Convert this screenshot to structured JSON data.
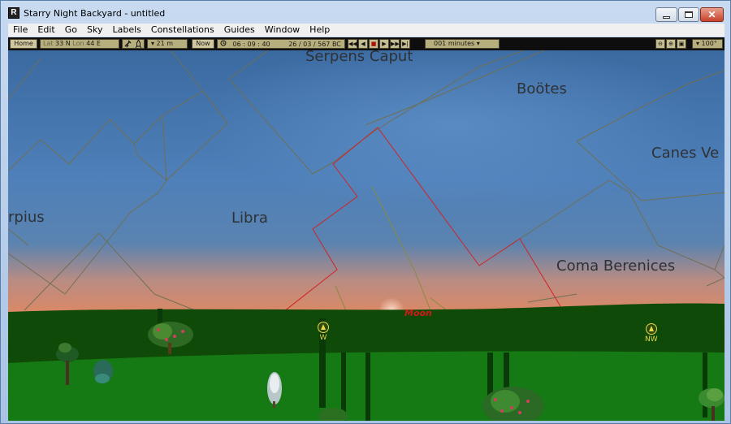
{
  "window": {
    "title": "Starry Night Backyard - untitled",
    "app_icon_glyph": "R",
    "controls": {
      "close_glyph": "✕"
    }
  },
  "menu": [
    "File",
    "Edit",
    "Go",
    "Sky",
    "Labels",
    "Constellations",
    "Guides",
    "Window",
    "Help"
  ],
  "toolbar": {
    "home_label": "Home",
    "lat_label": "Lat",
    "lat_value": "33 N",
    "lon_label": "Lon",
    "lon_value": "44 E",
    "elevation": "▾ 21 m",
    "now_label": "Now",
    "time": "06 : 09 : 40",
    "date": "26 / 03 /  567 BC",
    "playback": [
      "◀◀",
      "◀",
      "■",
      "▶",
      "▶▶",
      "▶|"
    ],
    "time_step": "001 minutes ▾",
    "zoom": [
      "⊖",
      "⊕",
      "▣"
    ],
    "fov": "▾ 100°"
  },
  "sky": {
    "constellations": [
      {
        "name": "Serpens Caput"
      },
      {
        "name": "Boötes"
      },
      {
        "name": "Canes Ve"
      },
      {
        "name": "rpius"
      },
      {
        "name": "Libra"
      },
      {
        "name": "Coma Berenices"
      }
    ],
    "moon_label": "Moon",
    "compass": [
      {
        "direction": "W",
        "icon": "compass-arrow-icon"
      },
      {
        "direction": "NW",
        "icon": "compass-arrow-icon"
      }
    ]
  },
  "colors": {
    "sky_top": "#3a6da3",
    "sky_mid": "#5183bd",
    "horizon_glow": "#e28a63",
    "ground_dark": "#0f4a08",
    "ground_light": "#157a14",
    "constellation_line": "#7a7a4e",
    "selected_boundary": "#d02323",
    "compass_yellow": "#e6d84a"
  }
}
